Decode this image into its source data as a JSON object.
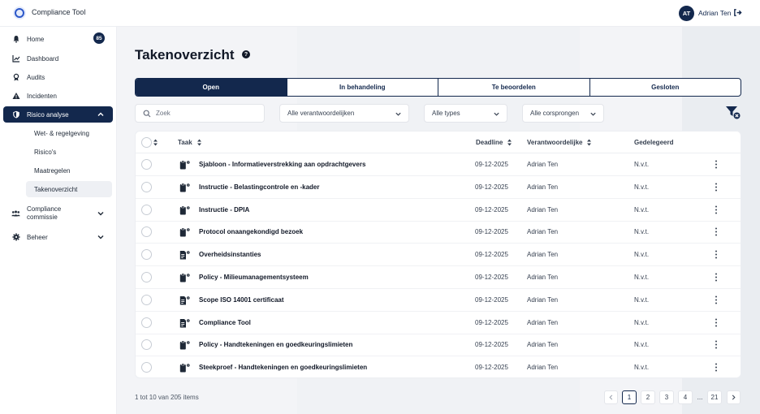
{
  "app": {
    "title": "Compliance Tool"
  },
  "user": {
    "initials": "AT",
    "name": "Adrian Ten"
  },
  "sidebar": {
    "items": [
      {
        "label": "Home",
        "badge": "85"
      },
      {
        "label": "Dashboard"
      },
      {
        "label": "Audits"
      },
      {
        "label": "Incidenten"
      },
      {
        "label": "Risico analyse"
      },
      {
        "label": "Compliance commissie"
      },
      {
        "label": "Beheer"
      }
    ],
    "sub_items": [
      {
        "label": "Wet- & regelgeving"
      },
      {
        "label": "Risico's"
      },
      {
        "label": "Maatregelen"
      },
      {
        "label": "Takenoverzicht"
      }
    ]
  },
  "page": {
    "title": "Takenoverzicht"
  },
  "tabs": [
    {
      "label": "Open",
      "active": true
    },
    {
      "label": "In behandeling"
    },
    {
      "label": "Te beoordelen"
    },
    {
      "label": "Gesloten"
    }
  ],
  "filters": {
    "search_placeholder": "Zoek",
    "owners": "Alle verantwoordelijken",
    "types": "Alle types",
    "origins": "Alle corsprongen"
  },
  "table": {
    "columns": {
      "task": "Taak",
      "deadline": "Deadline",
      "owner": "Verantwoordelijke",
      "delegated": "Gedelegeerd"
    },
    "rows": [
      {
        "title": "Sjabloon - Informatieverstrekking aan opdrachtgevers",
        "deadline": "09-12-2025",
        "owner": "Adrian Ten",
        "delegated": "N.v.t.",
        "icon": "clipboard-gear-icon"
      },
      {
        "title": "Instructie - Belastingcontrole en -kader",
        "deadline": "09-12-2025",
        "owner": "Adrian Ten",
        "delegated": "N.v.t.",
        "icon": "clipboard-gear-icon"
      },
      {
        "title": "Instructie - DPIA",
        "deadline": "09-12-2025",
        "owner": "Adrian Ten",
        "delegated": "N.v.t.",
        "icon": "clipboard-gear-icon"
      },
      {
        "title": "Protocol onaangekondigd bezoek",
        "deadline": "09-12-2025",
        "owner": "Adrian Ten",
        "delegated": "N.v.t.",
        "icon": "clipboard-gear-icon"
      },
      {
        "title": "Overheidsinstanties",
        "deadline": "09-12-2025",
        "owner": "Adrian Ten",
        "delegated": "N.v.t.",
        "icon": "document-gear-icon"
      },
      {
        "title": "Policy - Milieumanagementsysteem",
        "deadline": "09-12-2025",
        "owner": "Adrian Ten",
        "delegated": "N.v.t.",
        "icon": "clipboard-gear-icon"
      },
      {
        "title": "Scope ISO 14001 certificaat",
        "deadline": "09-12-2025",
        "owner": "Adrian Ten",
        "delegated": "N.v.t.",
        "icon": "document-gear-icon"
      },
      {
        "title": "Compliance Tool",
        "deadline": "09-12-2025",
        "owner": "Adrian Ten",
        "delegated": "N.v.t.",
        "icon": "document-gear-icon"
      },
      {
        "title": "Policy - Handtekeningen en goedkeuringslimieten",
        "deadline": "09-12-2025",
        "owner": "Adrian Ten",
        "delegated": "N.v.t.",
        "icon": "clipboard-gear-icon"
      },
      {
        "title": "Steekproef - Handtekeningen en goedkeuringslimieten",
        "deadline": "09-12-2025",
        "owner": "Adrian Ten",
        "delegated": "N.v.t.",
        "icon": "clipboard-gear-icon"
      }
    ]
  },
  "pagination": {
    "summary": "1 tot 10 van 205 items",
    "pages": [
      "1",
      "2",
      "3",
      "4"
    ],
    "ellipsis": "...",
    "last": "21",
    "current": "1"
  },
  "colors": {
    "primary": "#13284d",
    "accent": "#2c58c9"
  }
}
